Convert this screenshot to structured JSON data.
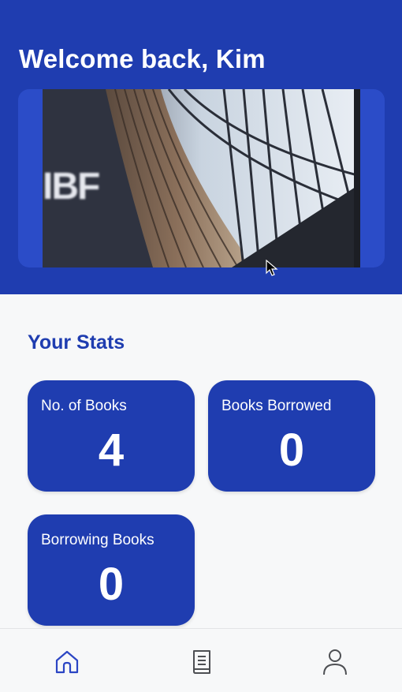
{
  "header": {
    "welcome_text": "Welcome back, Kim",
    "banner_logo_text": "IBF"
  },
  "stats": {
    "title": "Your Stats",
    "cards": [
      {
        "label": "No. of Books",
        "value": "4"
      },
      {
        "label": "Books Borrowed",
        "value": "0"
      },
      {
        "label": "Borrowing Books",
        "value": "0"
      }
    ]
  },
  "nav": {
    "items": [
      {
        "icon": "home-icon",
        "active": true
      },
      {
        "icon": "book-icon",
        "active": false
      },
      {
        "icon": "profile-icon",
        "active": false
      }
    ]
  },
  "colors": {
    "primary": "#1f3db0",
    "banner_frame": "#2b4cc8",
    "background": "#f7f8f9",
    "nav_active": "#2b45c4",
    "nav_inactive": "#4d4f53"
  }
}
